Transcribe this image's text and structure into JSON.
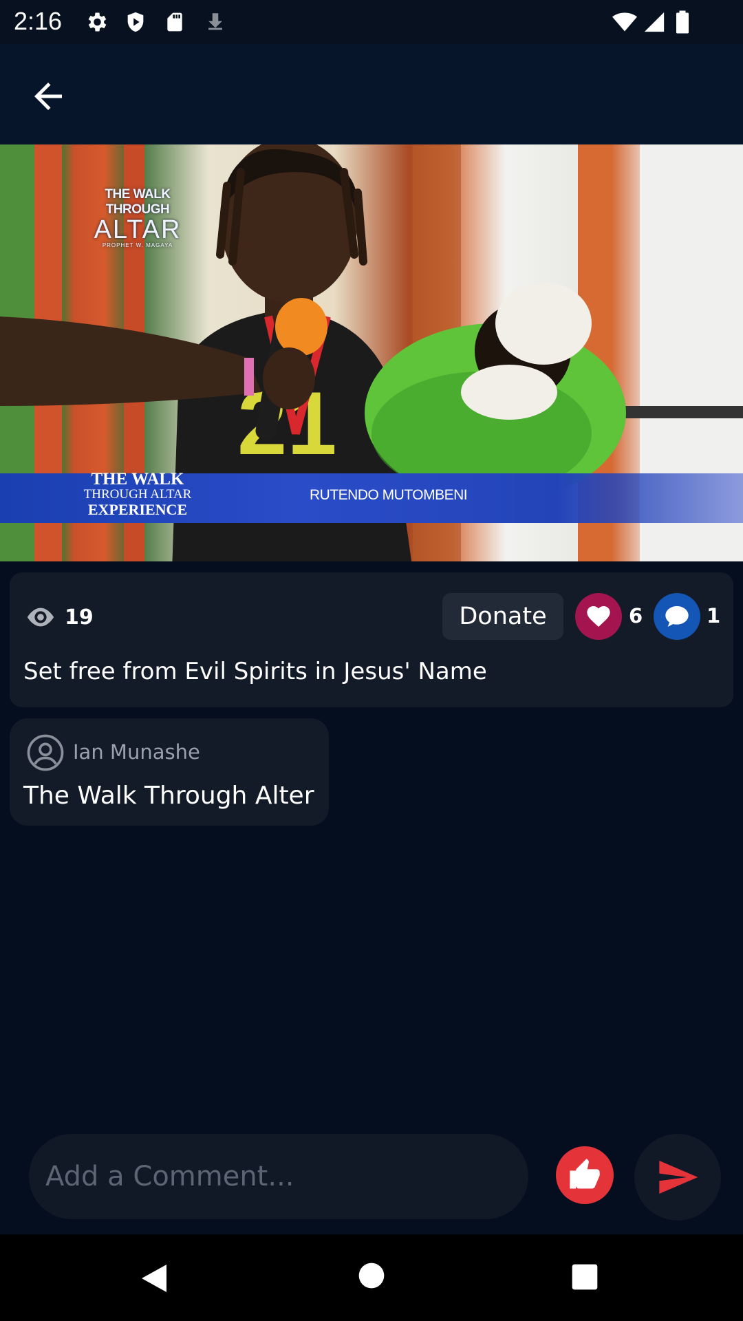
{
  "status_bar": {
    "time": "2:16",
    "icons": [
      "settings-icon",
      "shield-icon",
      "sd-card-icon",
      "download-icon",
      "wifi-icon",
      "signal-icon",
      "battery-icon"
    ]
  },
  "app_bar": {
    "back_icon": "arrow-back-icon"
  },
  "video": {
    "overlay_logo": {
      "line1": "THE WALK THROUGH",
      "line2": "ALTAR",
      "line3": "PROPHET W. MAGAYA"
    },
    "lower_third": {
      "brand_line1": "THE WALK",
      "brand_line2": "THROUGH ALTAR",
      "brand_line3": "EXPERIENCE",
      "name": "RUTENDO MUTOMBENI"
    }
  },
  "post": {
    "views": "19",
    "donate_label": "Donate",
    "likes": "6",
    "comments": "1",
    "title": "Set free from Evil Spirits in Jesus' Name"
  },
  "author": {
    "name": "Ian Munashe",
    "text": "The Walk Through Alter"
  },
  "comment_bar": {
    "placeholder": "Add a Comment..."
  },
  "colors": {
    "background": "#050e1e",
    "card": "#131a28",
    "like": "#a4154f",
    "comment": "#1456b6",
    "thumb": "#e5333a",
    "send": "#e5333a"
  }
}
